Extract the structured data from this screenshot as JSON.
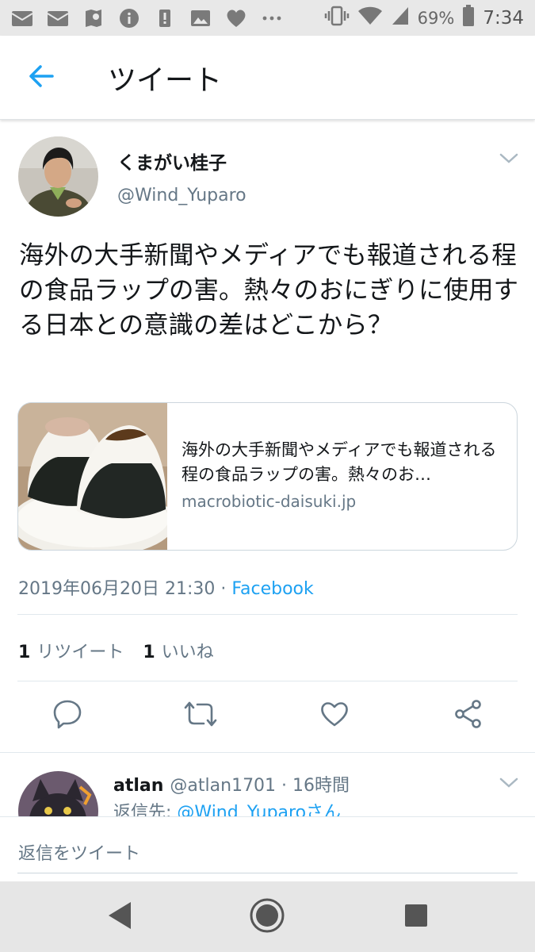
{
  "status_bar": {
    "battery": "69%",
    "time": "7:34",
    "icons": [
      "mail-icon",
      "mail-icon",
      "google-maps-icon",
      "info-icon",
      "alert-icon",
      "image-icon",
      "heart-icon",
      "more-icon",
      "vibrate-icon",
      "wifi-icon",
      "signal-icon",
      "battery-icon"
    ]
  },
  "header": {
    "title": "ツイート"
  },
  "tweet": {
    "user_name": "くまがい桂子",
    "handle": "@Wind_Yuparo",
    "text": "海外の大手新聞やメディアでも報道される程の食品ラップの害。熱々のおにぎりに使用する日本との意識の差はどこから？",
    "card": {
      "title": "海外の大手新聞やメディアでも報道される程の食品ラップの害。熱々のお…",
      "domain": "macrobiotic-daisuki.jp"
    },
    "timestamp": "2019年06月20日 21:30 ·",
    "source": "Facebook",
    "retweet_count": "1",
    "retweet_label": "リツイート",
    "like_count": "1",
    "like_label": "いいね"
  },
  "reply": {
    "name": "atlan",
    "handle_time": "@atlan1701 · 16時間",
    "reply_to_label": "返信先:",
    "reply_to_link": "@Wind_Yuparoさん"
  },
  "composer": {
    "placeholder": "返信をツイート"
  },
  "colors": {
    "accent": "#1da1f2",
    "muted": "#657786",
    "text": "#14171a"
  }
}
